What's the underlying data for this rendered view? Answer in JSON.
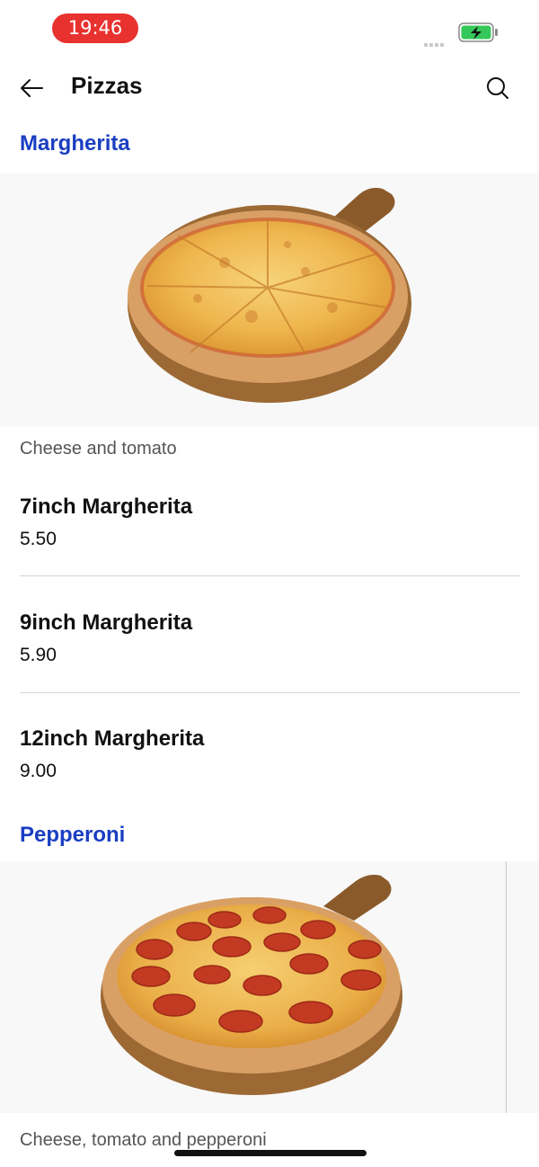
{
  "status_bar": {
    "time": "19:46"
  },
  "header": {
    "title": "Pizzas"
  },
  "sections": [
    {
      "title": "Margherita",
      "description": "Cheese and tomato",
      "items": [
        {
          "name": "7inch Margherita",
          "price": "5.50"
        },
        {
          "name": "9inch Margherita",
          "price": "5.90"
        },
        {
          "name": "12inch Margherita",
          "price": "9.00"
        }
      ]
    },
    {
      "title": "Pepperoni",
      "description": "Cheese, tomato and pepperoni"
    }
  ],
  "colors": {
    "accent": "#1a3ec2",
    "time_pill": "#e8322f",
    "battery": "#34c759"
  },
  "icons": [
    "back-arrow-icon",
    "search-icon",
    "battery-charging-icon",
    "signal-icon"
  ]
}
